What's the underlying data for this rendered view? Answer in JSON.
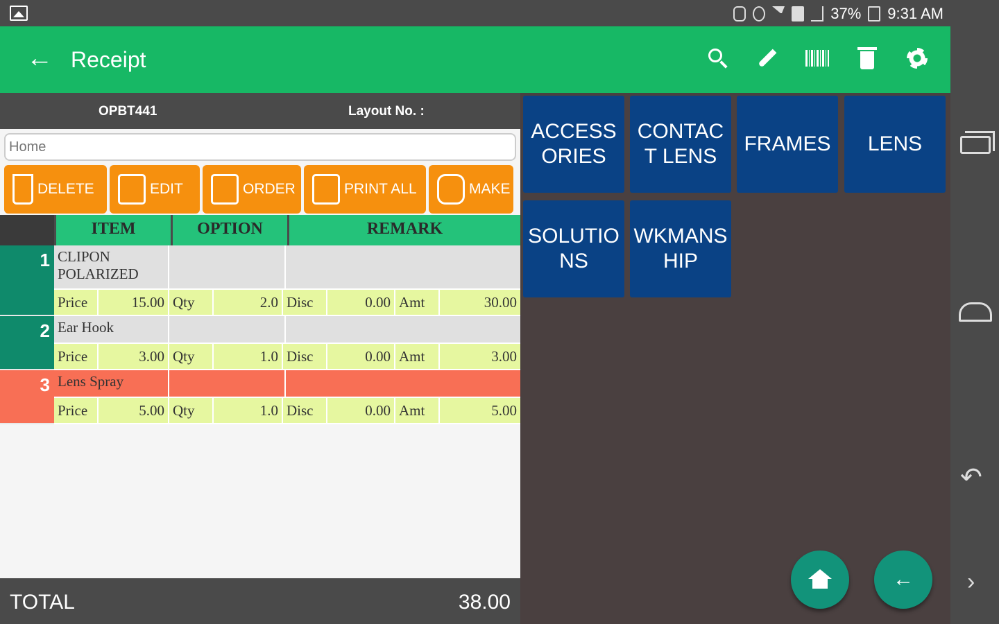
{
  "status_bar": {
    "battery": "37%",
    "time": "9:31 AM"
  },
  "app_bar": {
    "title": "Receipt",
    "actions": [
      "search-icon",
      "edit-icon",
      "barcode-icon",
      "delete-icon",
      "settings-icon"
    ]
  },
  "info": {
    "code": "OPBT441",
    "layout_label": "Layout No. :"
  },
  "search": {
    "placeholder": "Home"
  },
  "buttons": {
    "delete": "DELETE",
    "edit": "EDIT",
    "order": "ORDER",
    "print_all": "PRINT ALL",
    "make": "MAKE"
  },
  "table": {
    "headers": [
      "ITEM",
      "OPTION",
      "REMARK"
    ],
    "price_labels": {
      "price": "Price",
      "qty": "Qty",
      "disc": "Disc",
      "amt": "Amt"
    },
    "rows": [
      {
        "num": "1",
        "name": "CLIPON POLARIZED",
        "option": "",
        "remark": "",
        "price": "15.00",
        "qty": "2.0",
        "disc": "0.00",
        "amt": "30.00",
        "num_color": "#0f8a6b",
        "name_bg": "#e0e0e0"
      },
      {
        "num": "2",
        "name": "Ear Hook",
        "option": "",
        "remark": "",
        "price": "3.00",
        "qty": "1.0",
        "disc": "0.00",
        "amt": "3.00",
        "num_color": "#0f8a6b",
        "name_bg": "#e0e0e0"
      },
      {
        "num": "3",
        "name": "Lens Spray",
        "option": "",
        "remark": "",
        "price": "5.00",
        "qty": "1.0",
        "disc": "0.00",
        "amt": "5.00",
        "num_color": "#f86f55",
        "name_bg": "#f86f55"
      }
    ]
  },
  "total": {
    "label": "TOTAL",
    "value": "38.00"
  },
  "categories": [
    "ACCESSORIES",
    "CONTACT LENS",
    "FRAMES",
    "LENS",
    "SOLUTIONS",
    "WKMANSHIP"
  ],
  "colors": {
    "app_bar": "#17b865",
    "category_tile": "#0a4285",
    "action_button": "#f6900e",
    "fab": "#12937a"
  }
}
